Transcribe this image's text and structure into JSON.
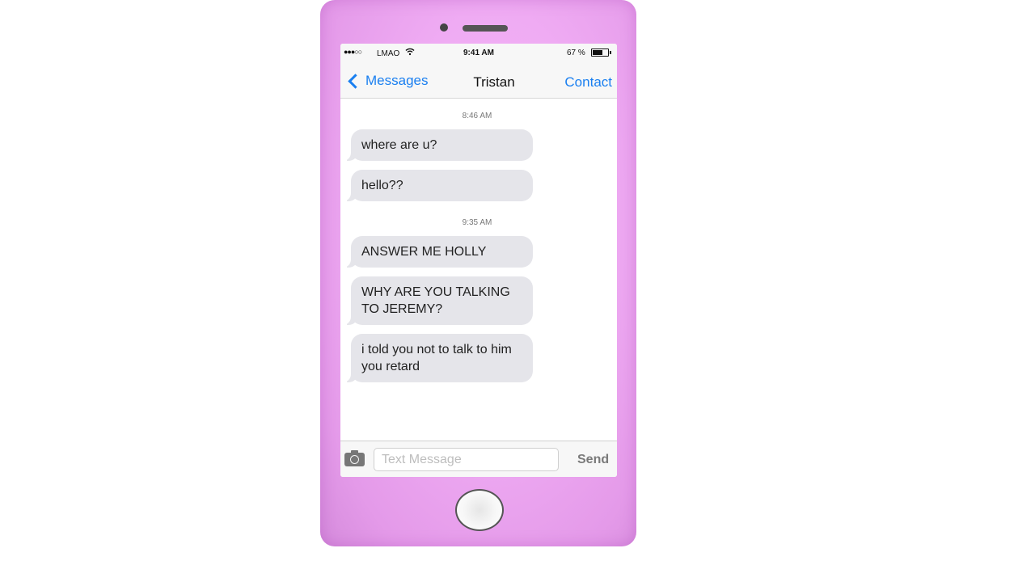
{
  "status_bar": {
    "signal": "●●●○○",
    "carrier": "LMAO",
    "time": "9:41 AM",
    "battery_percent": "67 %",
    "battery_level": 0.67
  },
  "nav": {
    "back_label": "Messages",
    "title": "Tristan",
    "contact_label": "Contact"
  },
  "conversation": {
    "timestamps": [
      "8:46 AM",
      "9:35 AM"
    ],
    "messages": [
      "where are u?",
      "hello??",
      "ANSWER ME HOLLY",
      "WHY ARE YOU TALKING TO JEREMY?",
      "i told you not to talk to him you retard"
    ]
  },
  "input": {
    "placeholder": "Text Message",
    "send_label": "Send"
  },
  "colors": {
    "phone_body": "#f0adf4",
    "link_blue": "#1a7ff0",
    "bubble_gray": "#e5e5ea"
  }
}
